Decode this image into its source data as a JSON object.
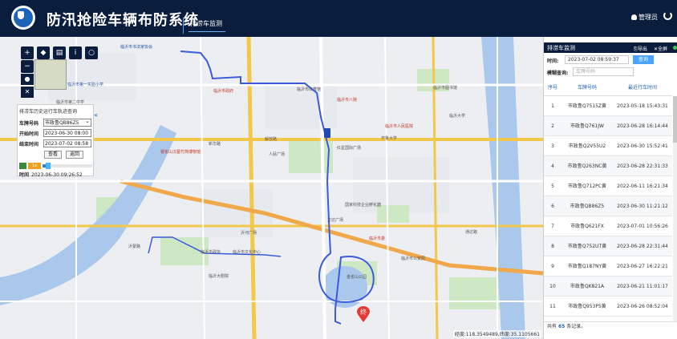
{
  "header": {
    "title": "防汛抢险车辆布防系统",
    "nav_tab": "排涝车监测",
    "user_label": "管理员"
  },
  "map": {
    "coords_text": "经度:118.3549489,纬度:35.1105661",
    "labels": [
      "临沂市书法家协会",
      "临沂市政府",
      "临沂市体育馆",
      "临沂市八院",
      "沂河广场",
      "万达广场",
      "临沂市人民医院",
      "临沂市文化中心",
      "金雀山公园",
      "红星国际广场",
      "齐鲁大学",
      "国家科技企业孵化器",
      "临沂市委",
      "临沂市公安局",
      "临沂市第一实验小学",
      "临沂市第二中学",
      "银雀山汉墓竹简博物馆",
      "临沂大学",
      "人民广场",
      "临沂市政协",
      "临沂市图书馆",
      "临沂大剧院",
      "沂蒙路",
      "新华路",
      "解放路",
      "通达路"
    ],
    "end_marker": "终"
  },
  "toolbar": {
    "zoom_in": "+",
    "zoom_out": "−",
    "buttons": [
      "tag-icon",
      "print-icon",
      "info-icon",
      "search-icon"
    ]
  },
  "track": {
    "title": "排涝车历史运行车轨迹查询",
    "plate_label": "车牌号码",
    "plate_value": "市政鲁QB86Z5",
    "start_label": "开始时间",
    "start_value": "2023-06-30 08:00",
    "end_label": "结束时间",
    "end_value": "2023-07-02 08:58",
    "query_button": "查看",
    "back_button": "返回",
    "speed_label": "1x",
    "progress_percent": 8,
    "time_label": "时间",
    "time_value": "2023-06-30 09:26:52"
  },
  "panel": {
    "title": "排涝车监测",
    "export_label": "导出",
    "fullscreen_label": "全屏",
    "time_label": "时间:",
    "time_value": "2023-07-02 08:59:37",
    "query_button": "查询",
    "fuzzy_label": "模糊查询:",
    "fuzzy_placeholder": "车牌号码",
    "columns": [
      "序号",
      "车牌号码",
      "最近行车时间"
    ],
    "rows": [
      [
        "1",
        "市政鲁Q7515Z黄",
        "2023-05-18 15:43:31"
      ],
      [
        "2",
        "市政鲁Q761JW",
        "2023-06-28 16:14:44"
      ],
      [
        "3",
        "市政鲁Q2V55U2",
        "2023-06-30 15:52:41"
      ],
      [
        "4",
        "市政鲁Q263NC黄",
        "2023-06-28 22:31:33"
      ],
      [
        "5",
        "市政鲁Q712PC黄",
        "2022-06-11 16:21:34"
      ],
      [
        "6",
        "市政鲁QB86Z5",
        "2023-06-30 11:21:12"
      ],
      [
        "7",
        "市政鲁Q621FX",
        "2023-07-01 10:56:26"
      ],
      [
        "8",
        "市政鲁Q752UT黄",
        "2023-06-28 22:31:44"
      ],
      [
        "9",
        "市政鲁Q187NY黄",
        "2023-06-27 16:22:21"
      ],
      [
        "10",
        "市政鲁QK821A",
        "2023-06-21 11:01:17"
      ],
      [
        "11",
        "市政鲁Q953P5黄",
        "2023-06-26 08:52:04"
      ]
    ],
    "footer_prefix": "共有",
    "footer_count": "65",
    "footer_suffix": "条记录。"
  },
  "colors": {
    "header_bg": "#0b1d3d",
    "accent": "#4aa3ff",
    "track_line": "#3b5bdb",
    "road_main": "#f5c542"
  }
}
